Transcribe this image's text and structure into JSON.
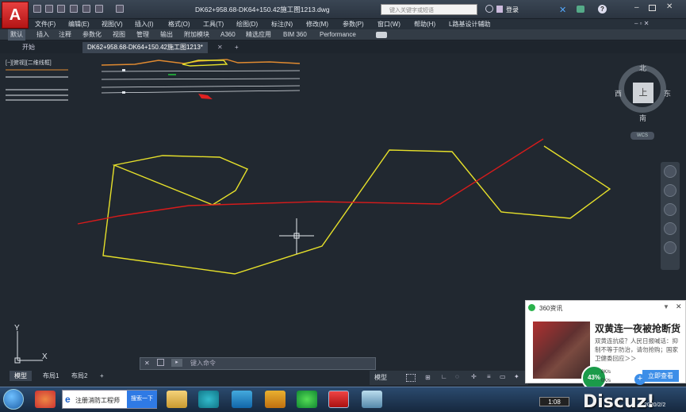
{
  "window": {
    "doc_title": "DK62+958.68-DK64+150.42施工图1213.dwg",
    "search_placeholder": "键入关键字或短语",
    "login": "登录",
    "help": "?"
  },
  "menubar": [
    "文件(F)",
    "编辑(E)",
    "视图(V)",
    "插入(I)",
    "格式(O)",
    "工具(T)",
    "绘图(D)",
    "标注(N)",
    "修改(M)",
    "参数(P)",
    "窗口(W)",
    "帮助(H)",
    "L路基设计辅助"
  ],
  "ribbon_tabs": [
    "默认",
    "插入",
    "注释",
    "参数化",
    "视图",
    "管理",
    "输出",
    "附加模块",
    "A360",
    "精选应用",
    "BIM 360",
    "Performance"
  ],
  "file_tabs": {
    "start": "开始",
    "drawing": "DK62+958.68-DK64+150.42施工图1213*",
    "add": "+"
  },
  "viewport_label": "[−][俯视][二维线框]",
  "viewcube": {
    "north": "北",
    "south": "南",
    "east": "东",
    "west": "西",
    "top": "上",
    "wcs": "WCS"
  },
  "ucs": {
    "x": "X",
    "y": "Y"
  },
  "command": {
    "placeholder": "键入命令"
  },
  "layout_tabs": [
    "模型",
    "布局1",
    "布局2",
    "+"
  ],
  "status": {
    "model": "模型"
  },
  "popup": {
    "source": "360资讯",
    "headline": "双黄连一夜被抢断货",
    "body": "双黄连抗疫？人民日报喊话：抑制不等于防治，请勿抢购；国家卫健委回应＞＞",
    "button": "立即查看",
    "gauge": "43%",
    "net1": "0K/s",
    "net2": "0K/s"
  },
  "taskbar": {
    "search_item": "注册消防工程师",
    "search_button": "搜索一下",
    "time": "1:08",
    "date": "2020/2/2"
  },
  "watermark": "Discuz!",
  "colors": {
    "canvas": "#212830",
    "yellow": "#e6e02a",
    "red": "#d81b1b",
    "orange": "#d9822b"
  }
}
